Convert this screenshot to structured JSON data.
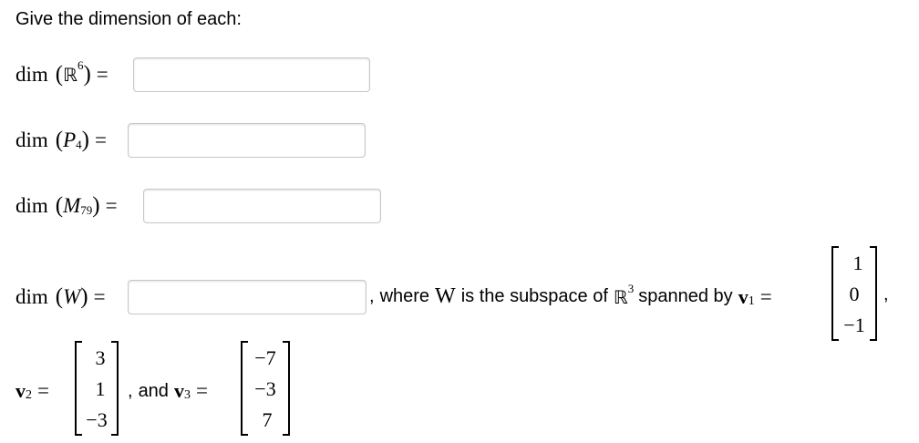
{
  "prompt": "Give the dimension of each:",
  "questions": [
    {
      "dim": "dim",
      "space": "ℝ",
      "sup": "6",
      "sub": "",
      "answer": ""
    },
    {
      "dim": "dim",
      "space": "P",
      "sup": "",
      "sub": "4",
      "answer": ""
    },
    {
      "dim": "dim",
      "space": "M",
      "sup": "",
      "sub": "79",
      "answer": ""
    },
    {
      "dim": "dim",
      "space": "W",
      "sup": "",
      "sub": "",
      "answer": ""
    }
  ],
  "w_description": {
    "comma": ",",
    "where": "where",
    "W": "W",
    "is_subspace_of": "is the subspace of",
    "R": "ℝ",
    "R_sup": "3",
    "spanned_by": "spanned by",
    "v1_letter": "v",
    "v1_sub": "1",
    "trailing_comma": ","
  },
  "vectors": {
    "v1": [
      "1",
      "0",
      "−1"
    ],
    "v2": [
      "3",
      "1",
      "−3"
    ],
    "v3": [
      "−7",
      "−3",
      "7"
    ]
  },
  "vector_labels": {
    "v2_letter": "v",
    "v2_sub": "2",
    "comma": ",",
    "and": "and",
    "v3_letter": "v",
    "v3_sub": "3"
  },
  "symbols": {
    "eq": "=",
    "lparen": "(",
    "rparen": ")"
  }
}
